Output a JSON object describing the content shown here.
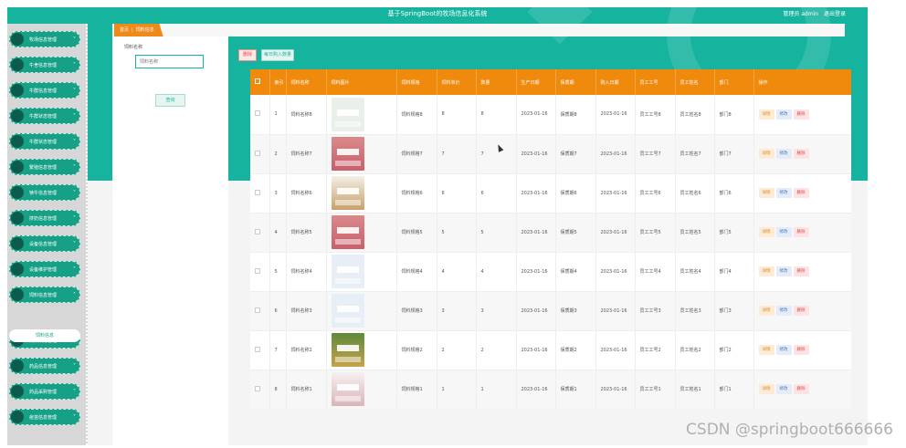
{
  "header": {
    "title": "基于SpringBoot的牧场信息化系统",
    "user_label": "管理员 admin",
    "logout": "退出登录"
  },
  "sidebar": {
    "items": [
      {
        "label": "牧场信息管理"
      },
      {
        "label": "牛舍信息管理"
      },
      {
        "label": "牛群信息管理"
      },
      {
        "label": "牛群状态管理"
      },
      {
        "label": "牛群状态管理"
      },
      {
        "label": "繁殖信息管理"
      },
      {
        "label": "犊牛信息管理"
      },
      {
        "label": "挤奶信息管理"
      },
      {
        "label": "设备信息管理"
      },
      {
        "label": "设备维护管理"
      },
      {
        "label": "饲料信息管理"
      },
      {
        "label": "饲料采购管理"
      },
      {
        "label": "药品信息管理"
      },
      {
        "label": "药品采购管理"
      },
      {
        "label": "疫苗信息管理"
      }
    ],
    "active_sub": "饲料信息"
  },
  "breadcrumb": {
    "home": "首页",
    "current": "饲料信息"
  },
  "search": {
    "label": "饲料名称",
    "placeholder": "饲料名称",
    "button": "查询"
  },
  "toolbar": {
    "delete": "删除",
    "warn": "每日购入数量"
  },
  "table": {
    "columns": [
      "索引",
      "饲料名称",
      "饲料图片",
      "饲料规格",
      "饲料单价",
      "数量",
      "生产日期",
      "保质期",
      "购入日期",
      "员工工号",
      "员工姓名",
      "部门",
      "操作"
    ],
    "actions": {
      "detail": "详情",
      "edit": "修改",
      "delete": "删除"
    },
    "rows": [
      {
        "index": "1",
        "name": "饲料名称8",
        "image": "white-bucket",
        "spec": "饲料规格8",
        "price": "8",
        "qty": "8",
        "prod": "2023-01-16",
        "shelf": "保质期8",
        "buy": "2023-01-16",
        "emp_no": "员工工号8",
        "emp_name": "员工姓名8",
        "dept": "部门8"
      },
      {
        "index": "2",
        "name": "饲料名称7",
        "image": "pink-bag",
        "spec": "饲料规格7",
        "price": "7",
        "qty": "7",
        "prod": "2023-01-16",
        "shelf": "保质期7",
        "buy": "2023-01-16",
        "emp_no": "员工工号7",
        "emp_name": "员工姓名7",
        "dept": "部门7"
      },
      {
        "index": "3",
        "name": "饲料名称6",
        "image": "grain-pile",
        "spec": "饲料规格6",
        "price": "6",
        "qty": "6",
        "prod": "2023-01-16",
        "shelf": "保质期6",
        "buy": "2023-01-16",
        "emp_no": "员工工号6",
        "emp_name": "员工姓名6",
        "dept": "部门6"
      },
      {
        "index": "4",
        "name": "饲料名称5",
        "image": "pink-bag",
        "spec": "饲料规格5",
        "price": "5",
        "qty": "5",
        "prod": "2023-01-16",
        "shelf": "保质期5",
        "buy": "2023-01-16",
        "emp_no": "员工工号5",
        "emp_name": "员工姓名5",
        "dept": "部门5"
      },
      {
        "index": "5",
        "name": "饲料名称4",
        "image": "white-sack",
        "spec": "饲料规格4",
        "price": "4",
        "qty": "4",
        "prod": "2023-01-16",
        "shelf": "保质期4",
        "buy": "2023-01-16",
        "emp_no": "员工工号4",
        "emp_name": "员工姓名4",
        "dept": "部门4"
      },
      {
        "index": "6",
        "name": "饲料名称3",
        "image": "white-sack",
        "spec": "饲料规格3",
        "price": "3",
        "qty": "3",
        "prod": "2023-01-16",
        "shelf": "保质期3",
        "buy": "2023-01-16",
        "emp_no": "员工工号3",
        "emp_name": "员工姓名3",
        "dept": "部门3"
      },
      {
        "index": "7",
        "name": "饲料名称2",
        "image": "green-bag",
        "spec": "饲料规格2",
        "price": "2",
        "qty": "2",
        "prod": "2023-01-16",
        "shelf": "保质期2",
        "buy": "2023-01-16",
        "emp_no": "员工工号2",
        "emp_name": "员工姓名2",
        "dept": "部门2"
      },
      {
        "index": "8",
        "name": "饲料名称1",
        "image": "red-white-sack",
        "spec": "饲料规格1",
        "price": "1",
        "qty": "1",
        "prod": "2023-01-16",
        "shelf": "保质期1",
        "buy": "2023-01-16",
        "emp_no": "员工工号1",
        "emp_name": "员工姓名1",
        "dept": "部门1"
      }
    ]
  },
  "watermark": "CSDN @springboot666666",
  "colors": {
    "teal": "#16b39e",
    "orange": "#f08a0c"
  }
}
